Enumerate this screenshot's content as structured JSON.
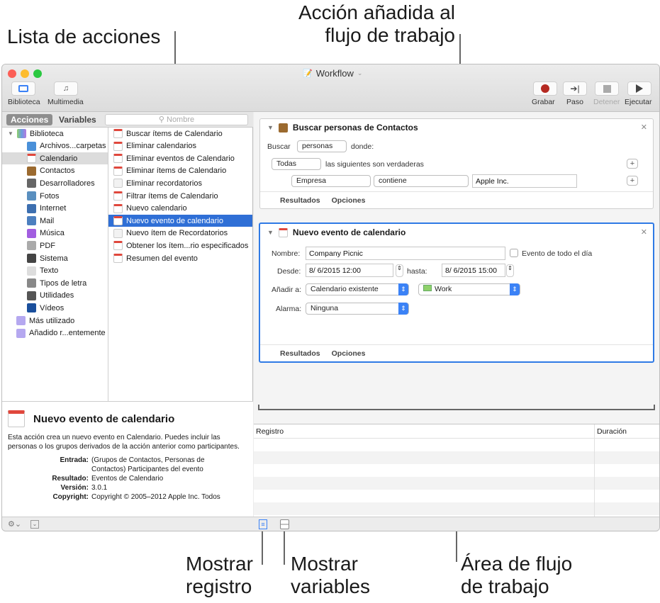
{
  "callouts": {
    "lista": "Lista de acciones",
    "accion_l1": "Acción añadida al",
    "accion_l2": "flujo de trabajo",
    "mostrar_reg_l1": "Mostrar",
    "mostrar_reg_l2": "registro",
    "mostrar_var_l1": "Mostrar",
    "mostrar_var_l2": "variables",
    "area_l1": "Área de flujo",
    "area_l2": "de trabajo"
  },
  "window": {
    "title": "Workflow"
  },
  "toolbar": {
    "biblioteca": "Biblioteca",
    "multimedia": "Multimedia",
    "grabar": "Grabar",
    "paso": "Paso",
    "detener": "Detener",
    "ejecutar": "Ejecutar"
  },
  "segments": {
    "acciones": "Acciones",
    "variables": "Variables",
    "search_placeholder": "Nombre"
  },
  "library": {
    "root": "Biblioteca",
    "items": [
      "Archivos...carpetas",
      "Calendario",
      "Contactos",
      "Desarrolladores",
      "Fotos",
      "Internet",
      "Mail",
      "Música",
      "PDF",
      "Sistema",
      "Texto",
      "Tipos de letra",
      "Utilidades",
      "Vídeos"
    ],
    "extra": [
      "Más utilizado",
      "Añadido r...entemente"
    ],
    "selected": "Calendario"
  },
  "actions": {
    "items": [
      "Buscar ítems de Calendario",
      "Eliminar calendarios",
      "Eliminar eventos de Calendario",
      "Eliminar ítems de Calendario",
      "Eliminar recordatorios",
      "Filtrar ítems de Calendario",
      "Nuevo calendario",
      "Nuevo evento de calendario",
      "Nuevo ítem de Recordatorios",
      "Obtener los ítem...rio especificados",
      "Resumen del evento"
    ],
    "selected": "Nuevo evento de calendario"
  },
  "description": {
    "title": "Nuevo evento de calendario",
    "body": "Esta acción crea un nuevo evento en Calendario. Puedes incluir las personas o los grupos derivados de la acción anterior como participantes.",
    "entrada_label": "Entrada:",
    "entrada": "(Grupos de Contactos, Personas de Contactos) Participantes del evento",
    "resultado_label": "Resultado:",
    "resultado": "Eventos de Calendario",
    "version_label": "Versión:",
    "version": "3.0.1",
    "copyright_label": "Copyright:",
    "copyright": "Copyright © 2005–2012 Apple Inc. Todos"
  },
  "card1": {
    "title": "Buscar personas de Contactos",
    "buscar": "Buscar",
    "personas": "personas",
    "donde": "donde:",
    "todas": "Todas",
    "verdaderas": "las siguientes son verdaderas",
    "empresa": "Empresa",
    "contiene": "contiene",
    "valor": "Apple Inc.",
    "resultados": "Resultados",
    "opciones": "Opciones"
  },
  "card2": {
    "title": "Nuevo evento de calendario",
    "nombre_label": "Nombre:",
    "nombre": "Company Picnic",
    "todo_dia": "Evento de todo el día",
    "desde_label": "Desde:",
    "desde": "8/  6/2015 12:00",
    "hasta_label": "hasta:",
    "hasta": "8/  6/2015 15:00",
    "anadir_label": "Añadir a:",
    "anadir": "Calendario existente",
    "calendario": "Work",
    "calendario_color": "#8fd16a",
    "alarma_label": "Alarma:",
    "alarma": "Ninguna",
    "resultados": "Resultados",
    "opciones": "Opciones"
  },
  "log": {
    "col_registro": "Registro",
    "col_duracion": "Duración"
  }
}
